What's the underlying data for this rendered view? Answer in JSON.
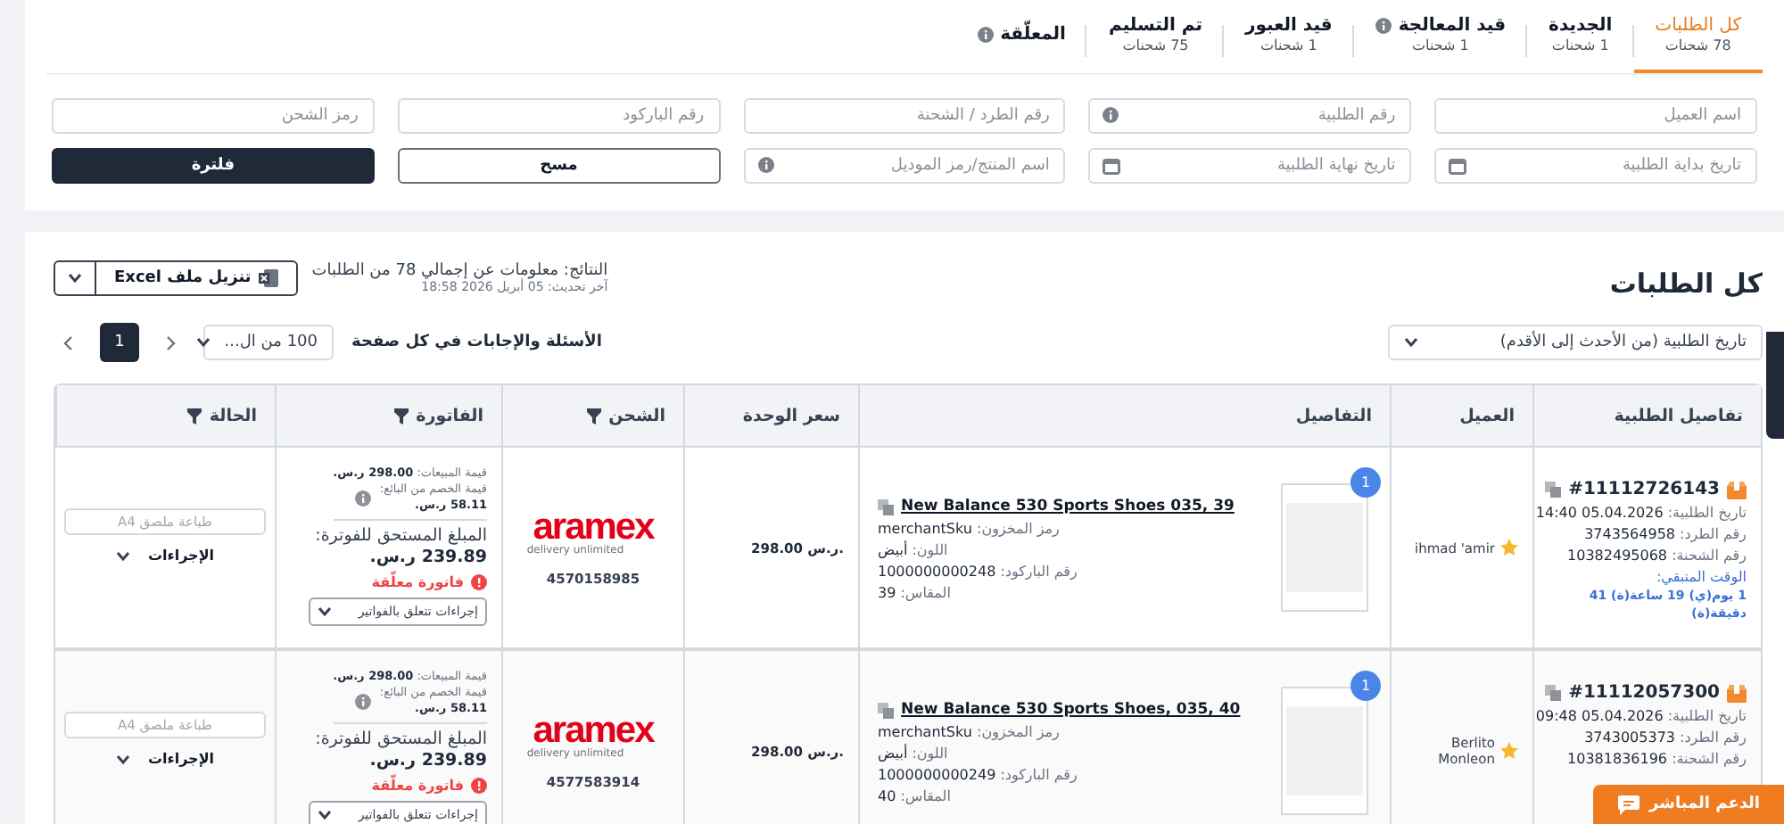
{
  "tabs": [
    {
      "label": "كل الطلبات",
      "count": "78 شحنات",
      "selected": true,
      "kind": "plain"
    },
    {
      "label": "الجديدة",
      "count": "1 شحنات",
      "selected": false,
      "kind": "plain"
    },
    {
      "label": "قيد المعالجة",
      "count": "1 شحنات",
      "selected": false,
      "kind": "info"
    },
    {
      "label": "قيد العبور",
      "count": "1 شحنات",
      "selected": false,
      "kind": "plain"
    },
    {
      "label": "تم التسليم",
      "count": "75 شحنات",
      "selected": false,
      "kind": "plain"
    },
    {
      "label": "المعلّقة",
      "selected": false,
      "kind": "info"
    }
  ],
  "filters": [
    {
      "placeholder": "اسم العميل",
      "kind": "text"
    },
    {
      "placeholder": "رقم الطلبية",
      "kind": "info"
    },
    {
      "placeholder": "رقم الطرد / الشحنة",
      "kind": "text"
    },
    {
      "placeholder": "رقم الباركود",
      "kind": "text"
    },
    {
      "placeholder": "رمز الشحن",
      "kind": "text"
    },
    {
      "placeholder": "تاريخ بداية الطلبية",
      "kind": "date"
    },
    {
      "placeholder": "تاريخ نهاية الطلبية",
      "kind": "date"
    },
    {
      "placeholder": "اسم المنتج/رمز الموديل",
      "kind": "info"
    }
  ],
  "filter_buttons": {
    "clear": "مسح",
    "apply": "فلترة"
  },
  "results": {
    "title": "كل الطلبات",
    "summary": "النتائج: معلومات عن إجمالي 78 من الطلبات",
    "updated": "آخر تحديث: 05 أبريل 2026 18:58",
    "export": "تنزيل ملف Excel",
    "sort": "تاريخ الطلبية (من الأحدث إلى الأقدم)",
    "per_page_label": "الأسئلة والإجابات في كل صفحة",
    "per_page": "100 من ال...",
    "pages": [
      {
        "label": "1",
        "selected": true
      }
    ]
  },
  "table": {
    "columns": [
      {
        "label": "تفاصيل الطلبية",
        "filter": false
      },
      {
        "label": "العميل",
        "filter": false
      },
      {
        "label": "التفاصيل",
        "filter": false
      },
      {
        "label": "سعر الوحدة",
        "filter": false
      },
      {
        "label": "الشحن",
        "filter": true
      },
      {
        "label": "الفاتورة",
        "filter": true
      },
      {
        "label": "الحالة",
        "filter": true
      }
    ],
    "rows": [
      {
        "order_number": "#11112726143",
        "info": [
          {
            "label": "تاريخ الطلبية:",
            "value": "14:40 05.04.2026"
          },
          {
            "label": "رقم الطرد:",
            "value": "3743564958"
          },
          {
            "label": "رقم الشحنة:",
            "value": "10382495068"
          }
        ],
        "remaining_label": "الوقت المتبقي:",
        "remaining": "1 يوم(ي) 19 ساعة(ة) 41 دقيقة(ة)",
        "customer": "ihmad 'amir",
        "product": "New Balance 530 Sports Shoes 035, 39",
        "quantity": "1",
        "attributes": [
          {
            "label": "رمز المخزون:",
            "value": "merchantSku"
          },
          {
            "label": "اللون:",
            "value": "أبيض"
          },
          {
            "label": "رقم الباركود:",
            "value": "1000000000248"
          },
          {
            "label": "المقاس:",
            "value": "39"
          }
        ],
        "unit_price": "298.00 ر.س.",
        "carrier": "aramex",
        "carrier_tagline": "delivery unlimited",
        "tracking": "4570158985",
        "sales_label": "قيمة المبيعات:",
        "sales": "298.00 ر.س.",
        "discount_label": "قيمة الخصم من البائع:",
        "discount": "58.11 ر.س.",
        "due_label": "المبلغ المستحق للفوترة:",
        "due": "239.89 ر.س.",
        "invoice_status": "فاتورة معلّقة",
        "invoice_actions": "إجراءات تتعلق بالفواتير",
        "print_label": "طباعة ملصق A4",
        "actions": "الإجراءات"
      },
      {
        "order_number": "#11112057300",
        "info": [
          {
            "label": "تاريخ الطلبية:",
            "value": "09:48 05.04.2026"
          },
          {
            "label": "رقم الطرد:",
            "value": "3743005373"
          },
          {
            "label": "رقم الشحنة:",
            "value": "10381836196"
          }
        ],
        "customer": "Berlito Monleon",
        "product": "New Balance 530 Sports Shoes, 035, 40",
        "quantity": "1",
        "attributes": [
          {
            "label": "رمز المخزون:",
            "value": "merchantSku"
          },
          {
            "label": "اللون:",
            "value": "أبيض"
          },
          {
            "label": "رقم الباركود:",
            "value": "1000000000249"
          },
          {
            "label": "المقاس:",
            "value": "40"
          }
        ],
        "unit_price": "298.00 ر.س.",
        "carrier": "aramex",
        "carrier_tagline": "delivery unlimited",
        "tracking": "4577583914",
        "sales_label": "قيمة المبيعات:",
        "sales": "298.00 ر.س.",
        "discount_label": "قيمة الخصم من البائع:",
        "discount": "58.11 ر.س.",
        "due_label": "المبلغ المستحق للفوترة:",
        "due": "239.89 ر.س.",
        "invoice_status": "فاتورة معلّقة",
        "invoice_actions": "إجراءات تتعلق بالفواتير",
        "print_label": "طباعة ملصق A4",
        "actions": "الإجراءات"
      }
    ]
  },
  "chat_button": "الدعم المباشر"
}
